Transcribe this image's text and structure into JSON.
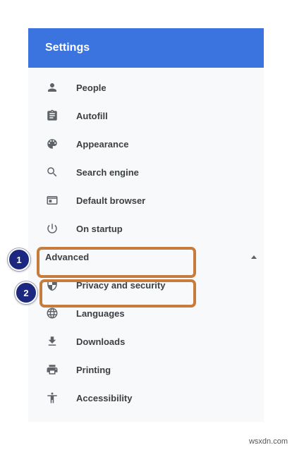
{
  "header": {
    "title": "Settings"
  },
  "menu": {
    "items": [
      {
        "label": "People",
        "icon": "person-icon"
      },
      {
        "label": "Autofill",
        "icon": "clipboard-icon"
      },
      {
        "label": "Appearance",
        "icon": "palette-icon"
      },
      {
        "label": "Search engine",
        "icon": "search-icon"
      },
      {
        "label": "Default browser",
        "icon": "browser-window-icon"
      },
      {
        "label": "On startup",
        "icon": "power-icon"
      }
    ],
    "advanced": {
      "label": "Advanced",
      "expanded": true
    },
    "advanced_items": [
      {
        "label": "Privacy and security",
        "icon": "shield-icon"
      },
      {
        "label": "Languages",
        "icon": "globe-icon"
      },
      {
        "label": "Downloads",
        "icon": "download-icon"
      },
      {
        "label": "Printing",
        "icon": "printer-icon"
      },
      {
        "label": "Accessibility",
        "icon": "accessibility-icon"
      }
    ]
  },
  "callouts": [
    {
      "number": "1"
    },
    {
      "number": "2"
    }
  ],
  "watermark": "wsxdn.com",
  "colors": {
    "header": "#3b73df",
    "panel": "#f8f9fa",
    "highlight": "#c67c3c",
    "badge": "#1c2880"
  }
}
